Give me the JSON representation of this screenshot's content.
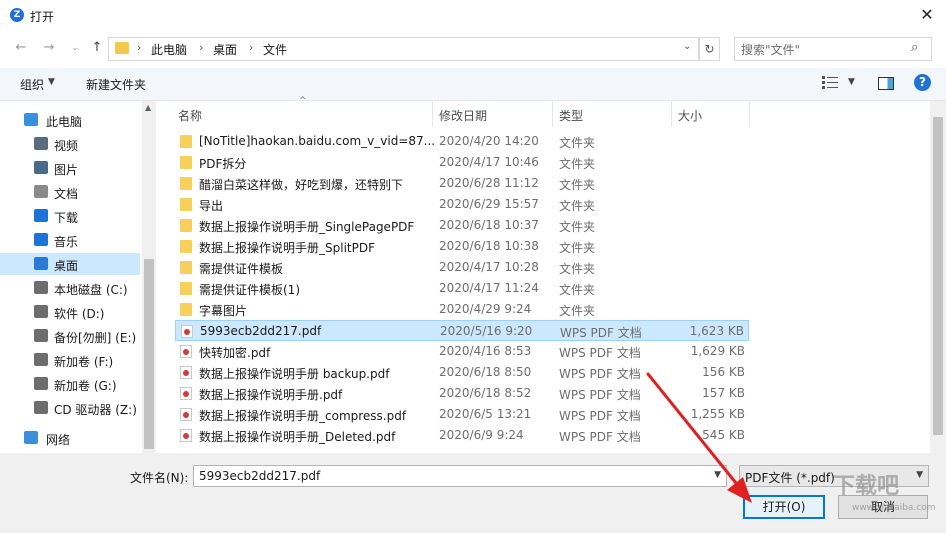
{
  "window": {
    "title": "打开"
  },
  "address": {
    "crumbs": [
      "此电脑",
      "桌面",
      "文件"
    ]
  },
  "search": {
    "placeholder": "搜索\"文件\""
  },
  "toolbar": {
    "organize": "组织",
    "new_folder": "新建文件夹"
  },
  "nav": {
    "items": [
      {
        "label": "此电脑",
        "icon": "computer-icon",
        "top": true
      },
      {
        "label": "视频",
        "icon": "video-icon"
      },
      {
        "label": "图片",
        "icon": "picture-icon"
      },
      {
        "label": "文档",
        "icon": "document-icon"
      },
      {
        "label": "下载",
        "icon": "download-icon"
      },
      {
        "label": "音乐",
        "icon": "music-icon"
      },
      {
        "label": "桌面",
        "icon": "desktop-icon",
        "selected": true
      },
      {
        "label": "本地磁盘 (C:)",
        "icon": "drive-icon"
      },
      {
        "label": "软件 (D:)",
        "icon": "drive-icon"
      },
      {
        "label": "备份[勿删] (E:)",
        "icon": "drive-icon"
      },
      {
        "label": "新加卷 (F:)",
        "icon": "drive-icon"
      },
      {
        "label": "新加卷 (G:)",
        "icon": "drive-icon"
      },
      {
        "label": "CD 驱动器 (Z:)",
        "icon": "cd-drive-icon"
      },
      {
        "label": "网络",
        "icon": "network-icon",
        "top": true
      }
    ]
  },
  "columns": {
    "name": "名称",
    "date": "修改日期",
    "type": "类型",
    "size": "大小"
  },
  "files": [
    {
      "name": "[NoTitle]haokan.baidu.com_v_vid=87...",
      "date": "2020/4/20 14:20",
      "type": "文件夹",
      "size": "",
      "kind": "folder"
    },
    {
      "name": "PDF拆分",
      "date": "2020/4/17 10:46",
      "type": "文件夹",
      "size": "",
      "kind": "folder"
    },
    {
      "name": "醋溜白菜这样做，好吃到爆，还特别下",
      "date": "2020/6/28 11:12",
      "type": "文件夹",
      "size": "",
      "kind": "folder"
    },
    {
      "name": "导出",
      "date": "2020/6/29 15:57",
      "type": "文件夹",
      "size": "",
      "kind": "folder"
    },
    {
      "name": "数据上报操作说明手册_SinglePagePDF",
      "date": "2020/6/18 10:37",
      "type": "文件夹",
      "size": "",
      "kind": "folder"
    },
    {
      "name": "数据上报操作说明手册_SplitPDF",
      "date": "2020/6/18 10:38",
      "type": "文件夹",
      "size": "",
      "kind": "folder"
    },
    {
      "name": "需提供证件模板",
      "date": "2020/4/17 10:28",
      "type": "文件夹",
      "size": "",
      "kind": "folder"
    },
    {
      "name": "需提供证件模板(1)",
      "date": "2020/4/17 11:24",
      "type": "文件夹",
      "size": "",
      "kind": "folder"
    },
    {
      "name": "字幕图片",
      "date": "2020/4/29 9:24",
      "type": "文件夹",
      "size": "",
      "kind": "folder"
    },
    {
      "name": "5993ecb2dd217.pdf",
      "date": "2020/5/16 9:20",
      "type": "WPS PDF 文档",
      "size": "1,623 KB",
      "kind": "pdf",
      "selected": true
    },
    {
      "name": "快转加密.pdf",
      "date": "2020/4/16 8:53",
      "type": "WPS PDF 文档",
      "size": "1,629 KB",
      "kind": "pdf"
    },
    {
      "name": "数据上报操作说明手册 backup.pdf",
      "date": "2020/6/18 8:50",
      "type": "WPS PDF 文档",
      "size": "156 KB",
      "kind": "pdf"
    },
    {
      "name": "数据上报操作说明手册.pdf",
      "date": "2020/6/18 8:52",
      "type": "WPS PDF 文档",
      "size": "157 KB",
      "kind": "pdf"
    },
    {
      "name": "数据上报操作说明手册_compress.pdf",
      "date": "2020/6/5 13:21",
      "type": "WPS PDF 文档",
      "size": "1,255 KB",
      "kind": "pdf"
    },
    {
      "name": "数据上报操作说明手册_Deleted.pdf",
      "date": "2020/6/9 9:24",
      "type": "WPS PDF 文档",
      "size": "545 KB",
      "kind": "pdf"
    }
  ],
  "bottom": {
    "filename_label": "文件名(N):",
    "filename_value": "5993ecb2dd217.pdf",
    "filter_value": "PDF文件 (*.pdf)",
    "open_label": "打开(O)",
    "cancel_label": "取消"
  },
  "watermark": {
    "text": "下载吧",
    "sub": "www.xiazaiba.com"
  },
  "colors": {
    "accent": "#0078d7",
    "selection": "#cce8ff",
    "arrow": "#e02020"
  }
}
